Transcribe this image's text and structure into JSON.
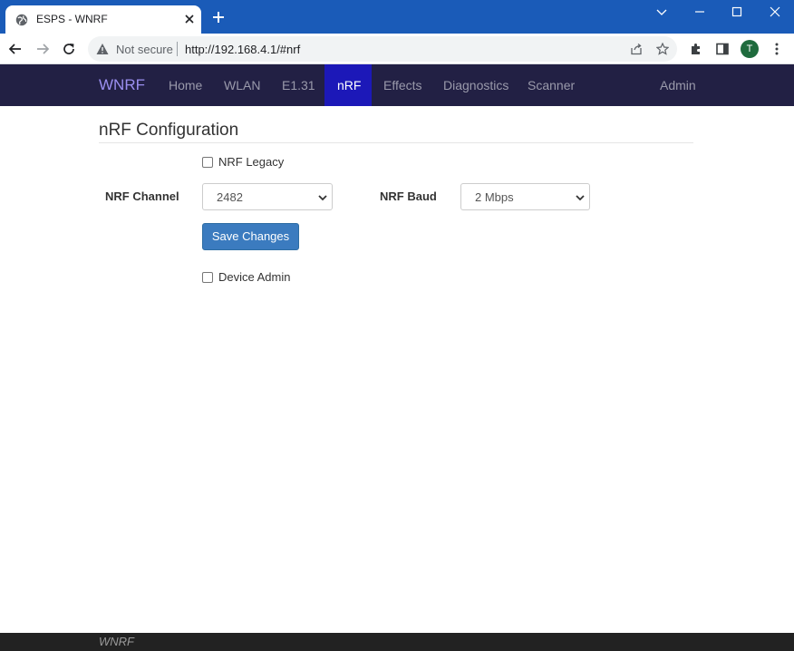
{
  "browser": {
    "tab_title": "ESPS - WNRF",
    "security_label": "Not secure",
    "url": "http://192.168.4.1/#nrf",
    "profile_initial": "T",
    "icons": [
      "globe-icon",
      "close-icon",
      "plus-icon",
      "back-arrow-icon",
      "forward-arrow-icon",
      "reload-icon",
      "warning-icon",
      "share-icon",
      "star-icon",
      "extensions-icon",
      "sidepanel-icon",
      "kebab-menu-icon",
      "minimize-icon",
      "maximize-icon",
      "window-close-icon",
      "tab-search-chevron-icon"
    ]
  },
  "nav": {
    "brand": "WNRF",
    "items": [
      {
        "label": "Home"
      },
      {
        "label": "WLAN"
      },
      {
        "label": "E1.31"
      },
      {
        "label": "nRF",
        "active": true
      },
      {
        "label": "Effects"
      },
      {
        "label": "Diagnostics"
      },
      {
        "label": "Scanner"
      }
    ],
    "admin": "Admin",
    "colors": {
      "bar": "#222044",
      "active": "#1c18b8",
      "brand": "#9b8ff0"
    }
  },
  "page": {
    "title": "nRF Configuration",
    "legacy_label": "NRF Legacy",
    "legacy_checked": false,
    "channel_label": "NRF Channel",
    "channel_value": "2482",
    "baud_label": "NRF Baud",
    "baud_value": "2 Mbps",
    "save_label": "Save Changes",
    "admin_label": "Device Admin",
    "admin_checked": false
  },
  "footer": {
    "text": "WNRF"
  }
}
